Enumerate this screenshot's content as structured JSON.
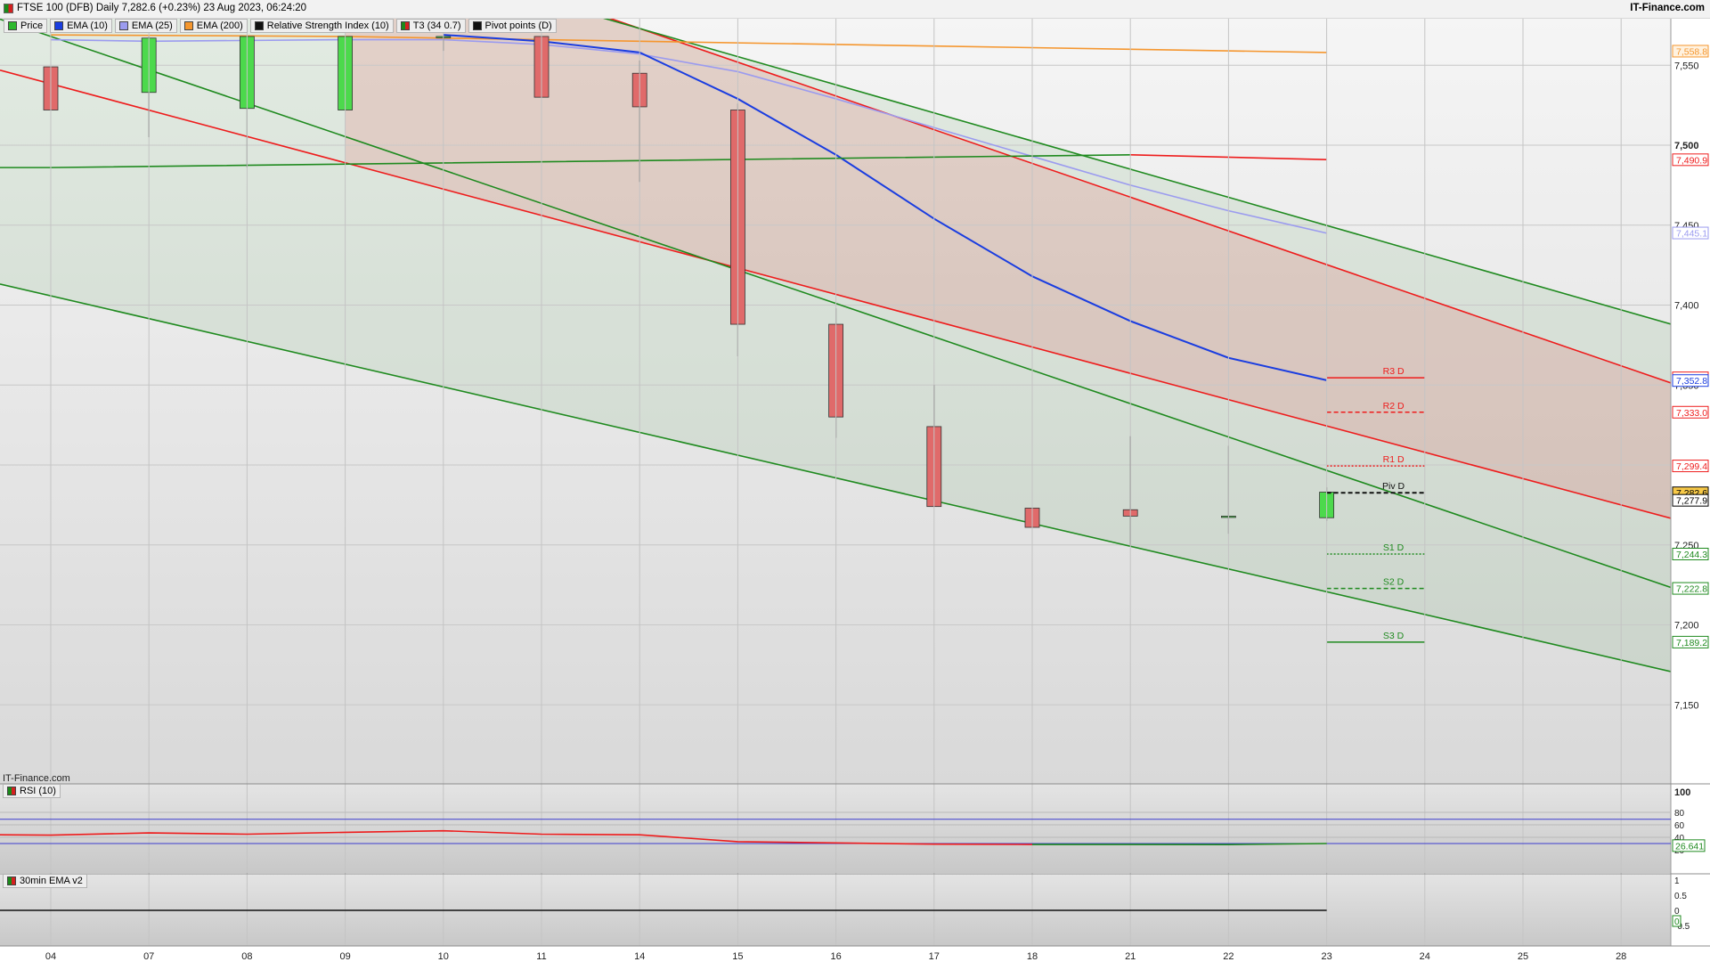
{
  "header": {
    "title": "FTSE 100 (DFB) Daily 7,282.6 (+0.23%) 23 Aug 2023, 06:24:20",
    "brand": "IT-Finance.com"
  },
  "legend": [
    {
      "label": "Price",
      "color": "#2eb82e",
      "icon": "price-swatch"
    },
    {
      "label": "EMA (10)",
      "color": "#1a3de0",
      "icon": "ema10-swatch"
    },
    {
      "label": "EMA (25)",
      "color": "#9b9bef",
      "icon": "ema25-swatch"
    },
    {
      "label": "EMA (200)",
      "color": "#f5962e",
      "icon": "ema200-swatch"
    },
    {
      "label": "Relative Strength Index (10)",
      "color": "#111111",
      "icon": "rsi-swatch"
    },
    {
      "label": "T3 (34 0.7)",
      "color": "#d42020",
      "icon": "t3-swatch"
    },
    {
      "label": "Pivot points (D)",
      "color": "#111111",
      "icon": "pivot-swatch"
    }
  ],
  "watermark": "IT-Finance.com",
  "rsi_pane": {
    "label": "RSI (10)",
    "value_label": "26.641"
  },
  "ema_pane": {
    "label": "30min EMA v2"
  },
  "colors": {
    "up": "#4cd94c",
    "down": "#e06a6a",
    "red": "#ee1c1c",
    "green": "#1f8a1f"
  },
  "chart_data": [
    {
      "type": "candlestick",
      "x": [
        "04",
        "07",
        "08",
        "09",
        "10",
        "11",
        "14",
        "15",
        "16",
        "17",
        "18",
        "21",
        "22",
        "23",
        "24",
        "25",
        "28"
      ],
      "ylim": [
        7100,
        7565
      ],
      "y_ticks": [
        "7,550",
        "7,500",
        "7,450",
        "7,400",
        "7,350",
        "7,300",
        "7,250",
        "7,200",
        "7,150"
      ],
      "candles": [
        {
          "x": "04",
          "open": 7549,
          "high": 7568,
          "low": 7485,
          "close": 7522
        },
        {
          "x": "07",
          "open": 7533,
          "high": 7568,
          "low": 7505,
          "close": 7567
        },
        {
          "x": "08",
          "open": 7523,
          "high": 7568,
          "low": 7486,
          "close": 7568
        },
        {
          "x": "09",
          "open": 7522,
          "high": 7568,
          "low": 7522,
          "close": 7568
        },
        {
          "x": "10",
          "open": 7568,
          "high": 7568,
          "low": 7559,
          "close": 7568
        },
        {
          "x": "11",
          "open": 7568,
          "high": 7568,
          "low": 7507,
          "close": 7530
        },
        {
          "x": "14",
          "open": 7545,
          "high": 7553,
          "low": 7477,
          "close": 7524
        },
        {
          "x": "15",
          "open": 7522,
          "high": 7526,
          "low": 7368,
          "close": 7388
        },
        {
          "x": "16",
          "open": 7388,
          "high": 7398,
          "low": 7317,
          "close": 7330
        },
        {
          "x": "17",
          "open": 7324,
          "high": 7350,
          "low": 7274,
          "close": 7274
        },
        {
          "x": "18",
          "open": 7273,
          "high": 7300,
          "low": 7213,
          "close": 7261
        },
        {
          "x": "21",
          "open": 7272,
          "high": 7318,
          "low": 7250,
          "close": 7268
        },
        {
          "x": "22",
          "open": 7268,
          "high": 7312,
          "low": 7257,
          "close": 7268
        },
        {
          "x": "23",
          "open": 7267,
          "high": 7286,
          "low": 7265,
          "close": 7283
        }
      ],
      "overlays": [
        {
          "name": "EMA (200)",
          "color": "#f5962e",
          "points": [
            [
              "04",
              7569
            ],
            [
              "09",
              7568
            ],
            [
              "14",
              7565
            ],
            [
              "17",
              7562
            ],
            [
              "21",
              7560
            ],
            [
              "23",
              7558
            ]
          ]
        },
        {
          "name": "EMA (25)",
          "color": "#9b9bef",
          "points": [
            [
              "04",
              7566
            ],
            [
              "07",
              7565
            ],
            [
              "09",
              7566
            ],
            [
              "10",
              7566
            ],
            [
              "11",
              7563
            ],
            [
              "14",
              7557
            ],
            [
              "15",
              7546
            ],
            [
              "16",
              7529
            ],
            [
              "17",
              7511
            ],
            [
              "18",
              7493
            ],
            [
              "21",
              7475
            ],
            [
              "22",
              7459
            ],
            [
              "23",
              7445
            ]
          ]
        },
        {
          "name": "EMA (10)",
          "color": "#1a3de0",
          "points": [
            [
              "10",
              7569
            ],
            [
              "11",
              7565
            ],
            [
              "14",
              7558
            ],
            [
              "15",
              7529
            ],
            [
              "16",
              7494
            ],
            [
              "17",
              7454
            ],
            [
              "18",
              7418
            ],
            [
              "21",
              7390
            ],
            [
              "22",
              7367
            ],
            [
              "23",
              7353
            ]
          ]
        },
        {
          "name": "T3 (34 0.7)",
          "color": "green-red",
          "points": [
            [
              "03",
              7486
            ],
            [
              "04",
              7486
            ],
            [
              "21",
              7494
            ],
            [
              "23",
              7491
            ]
          ]
        }
      ],
      "trendlines": [
        {
          "color": "red",
          "from": [
            "14",
            7573
          ],
          "to": [
            "28",
            7362
          ]
        },
        {
          "color": "red",
          "from": [
            "09",
            7489
          ],
          "to": [
            "28",
            7275
          ]
        },
        {
          "color": "green",
          "from": [
            "14",
            7573
          ],
          "to": [
            "28",
            7397
          ]
        },
        {
          "color": "green",
          "from": [
            "04",
            7568
          ],
          "to": [
            "28",
            7234
          ]
        },
        {
          "color": "green",
          "from": [
            "03",
            7420
          ],
          "to": [
            "28",
            7178
          ]
        }
      ],
      "pivots": [
        {
          "label": "R3 D",
          "value": 7354.5,
          "color": "#ee1c1c",
          "style": "solid"
        },
        {
          "label": "R2 D",
          "value": 7333.0,
          "color": "#ee1c1c",
          "style": "dashed"
        },
        {
          "label": "R1 D",
          "value": 7299.4,
          "color": "#ee1c1c",
          "style": "dotted"
        },
        {
          "label": "Piv D",
          "value": 7282.6,
          "color": "#111111",
          "style": "dashed"
        },
        {
          "label": "S1 D",
          "value": 7244.3,
          "color": "#1f8a1f",
          "style": "dotted"
        },
        {
          "label": "S2 D",
          "value": 7222.8,
          "color": "#1f8a1f",
          "style": "dashed"
        },
        {
          "label": "S3 D",
          "value": 7189.2,
          "color": "#1f8a1f",
          "style": "solid"
        }
      ],
      "price_tags": [
        {
          "value": 7558.8,
          "label": "7,558.8",
          "color": "#f5962e",
          "bg": "#fff2e0"
        },
        {
          "value": 7490.9,
          "label": "7,490.9",
          "color": "#ee1c1c",
          "bg": "#ffffff"
        },
        {
          "value": 7445.1,
          "label": "7,445.1",
          "color": "#9b9bef",
          "bg": "#ffffff"
        },
        {
          "value": 7354.5,
          "label": "7,354.5",
          "color": "#ee1c1c",
          "bg": "#ffffff"
        },
        {
          "value": 7352.8,
          "label": "7,352.8",
          "color": "#1a3de0",
          "bg": "#ffffff"
        },
        {
          "value": 7333.0,
          "label": "7,333.0",
          "color": "#ee1c1c",
          "bg": "#ffffff"
        },
        {
          "value": 7299.4,
          "label": "7,299.4",
          "color": "#ee1c1c",
          "bg": "#ffffff"
        },
        {
          "value": 7282.6,
          "label": "7,282.6",
          "color": "#000000",
          "bg": "#f7c948"
        },
        {
          "value": 7277.9,
          "label": "7,277.9",
          "color": "#000000",
          "bg": "#ffffff"
        },
        {
          "value": 7244.3,
          "label": "7,244.3",
          "color": "#1f8a1f",
          "bg": "#ffffff"
        },
        {
          "value": 7222.8,
          "label": "7,222.8",
          "color": "#1f8a1f",
          "bg": "#ffffff"
        },
        {
          "value": 7189.2,
          "label": "7,189.2",
          "color": "#1f8a1f",
          "bg": "#ffffff"
        }
      ]
    },
    {
      "type": "line",
      "title": "RSI (10)",
      "ylim": [
        0,
        100
      ],
      "y_ticks": [
        "100",
        "80",
        "60",
        "40",
        "20"
      ],
      "bands": [
        69,
        30
      ],
      "points": [
        [
          "03",
          44.5
        ],
        [
          "04",
          43.5
        ],
        [
          "07",
          47
        ],
        [
          "08",
          45
        ],
        [
          "09",
          48
        ],
        [
          "10",
          50.5
        ],
        [
          "11",
          45
        ],
        [
          "14",
          44
        ],
        [
          "15",
          33
        ],
        [
          "16",
          31
        ],
        [
          "17",
          29
        ],
        [
          "18",
          28.5
        ],
        [
          "21",
          28.5
        ],
        [
          "22",
          28.3
        ],
        [
          "23",
          30
        ]
      ],
      "value_label": "26.641"
    },
    {
      "type": "line",
      "title": "30min EMA v2",
      "ylim": [
        -0.75,
        1.25
      ],
      "y_ticks": [
        "1",
        "0.5",
        "0",
        "-0.5"
      ],
      "points": [
        [
          "03",
          0
        ],
        [
          "23",
          0
        ]
      ],
      "value_label": "0"
    }
  ]
}
